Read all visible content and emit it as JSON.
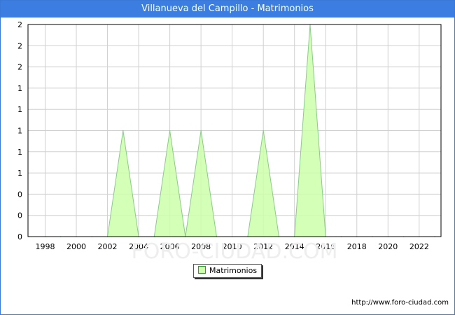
{
  "title": "Villanueva del Campillo - Matrimonios",
  "source_url": "http://www.foro-ciudad.com",
  "watermark": "FORO-CIUDAD.COM",
  "colors": {
    "title_bar": "#3b7de0",
    "series_fill": "#ccffaa",
    "series_line": "#88cc88",
    "grid": "#d0d0d0"
  },
  "chart_data": {
    "type": "area",
    "title": "Villanueva del Campillo - Matrimonios",
    "xlabel": "",
    "ylabel": "",
    "x_ticks": [
      "1998",
      "2000",
      "2002",
      "2004",
      "2006",
      "2008",
      "2010",
      "2012",
      "2014",
      "2016",
      "2018",
      "2020",
      "2022"
    ],
    "y_tick_labels": [
      "0",
      "0",
      "0",
      "1",
      "1",
      "1",
      "1",
      "1",
      "2",
      "2",
      "2"
    ],
    "ylim": [
      0,
      2
    ],
    "xlim": [
      1996.9,
      2023.4
    ],
    "grid": true,
    "legend_position": "bottom-center",
    "series": [
      {
        "name": "Matrimonios",
        "x": [
          1997,
          1998,
          1999,
          2000,
          2001,
          2002,
          2003,
          2004,
          2005,
          2006,
          2007,
          2008,
          2009,
          2010,
          2011,
          2012,
          2013,
          2014,
          2015,
          2016,
          2017,
          2018,
          2019,
          2020,
          2021,
          2022,
          2023
        ],
        "values": [
          0,
          0,
          0,
          0,
          0,
          0,
          1,
          0,
          0,
          1,
          0,
          1,
          0,
          0,
          0,
          1,
          0,
          0,
          2,
          0,
          0,
          0,
          0,
          0,
          0,
          0,
          0
        ]
      }
    ]
  }
}
